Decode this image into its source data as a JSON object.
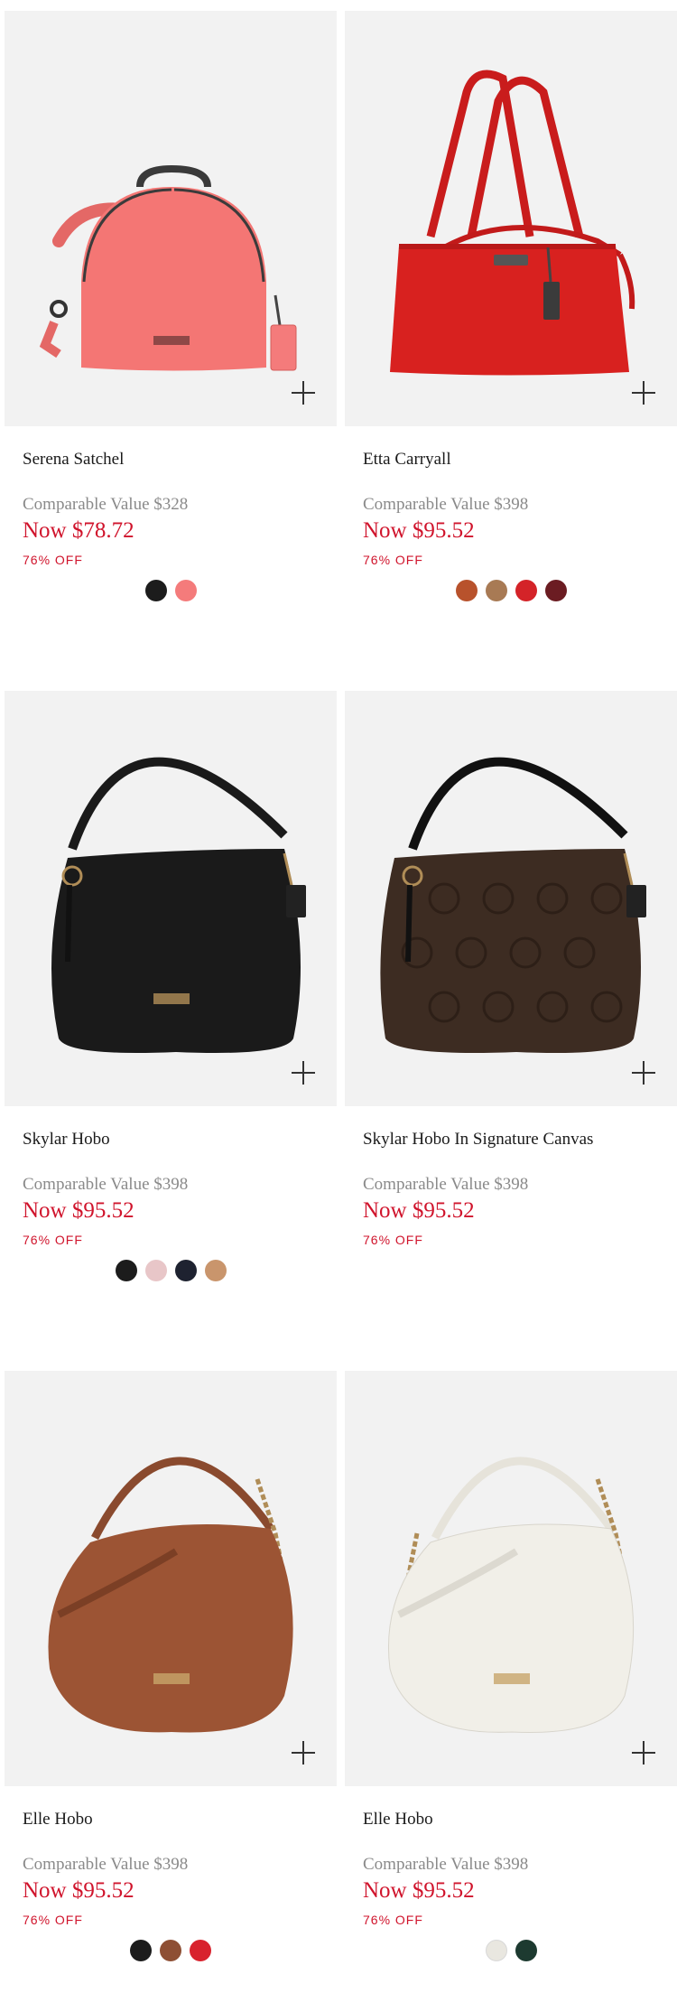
{
  "products": [
    {
      "name": "Serena Satchel",
      "comparable": "Comparable Value $328",
      "price": "Now $78.72",
      "discount": "76% OFF",
      "bag_color": "#f47674",
      "swatches": [
        "#1c1c1c",
        "#f47b7b"
      ]
    },
    {
      "name": "Etta Carryall",
      "comparable": "Comparable Value $398",
      "price": "Now $95.52",
      "discount": "76% OFF",
      "bag_color": "#d8211f",
      "swatches": [
        "#b8522c",
        "#a87a54",
        "#d42328",
        "#6b1c22"
      ]
    },
    {
      "name": "Skylar Hobo",
      "comparable": "Comparable Value $398",
      "price": "Now $95.52",
      "discount": "76% OFF",
      "bag_color": "#1a1a1a",
      "swatches": [
        "#1c1c1c",
        "#e8c6c8",
        "#1e2230",
        "#c9956c"
      ]
    },
    {
      "name": "Skylar Hobo In Signature Canvas",
      "comparable": "Comparable Value $398",
      "price": "Now $95.52",
      "discount": "76% OFF",
      "bag_color": "#3d2c22",
      "swatches": []
    },
    {
      "name": "Elle Hobo",
      "comparable": "Comparable Value $398",
      "price": "Now $95.52",
      "discount": "76% OFF",
      "bag_color": "#9c5434",
      "swatches": [
        "#1c1c1c",
        "#8e4f34",
        "#d8222d"
      ]
    },
    {
      "name": "Elle Hobo",
      "comparable": "Comparable Value $398",
      "price": "Now $95.52",
      "discount": "76% OFF",
      "bag_color": "#f1efe8",
      "swatches": [
        "#e9e7e0",
        "#1d3a30"
      ]
    }
  ]
}
